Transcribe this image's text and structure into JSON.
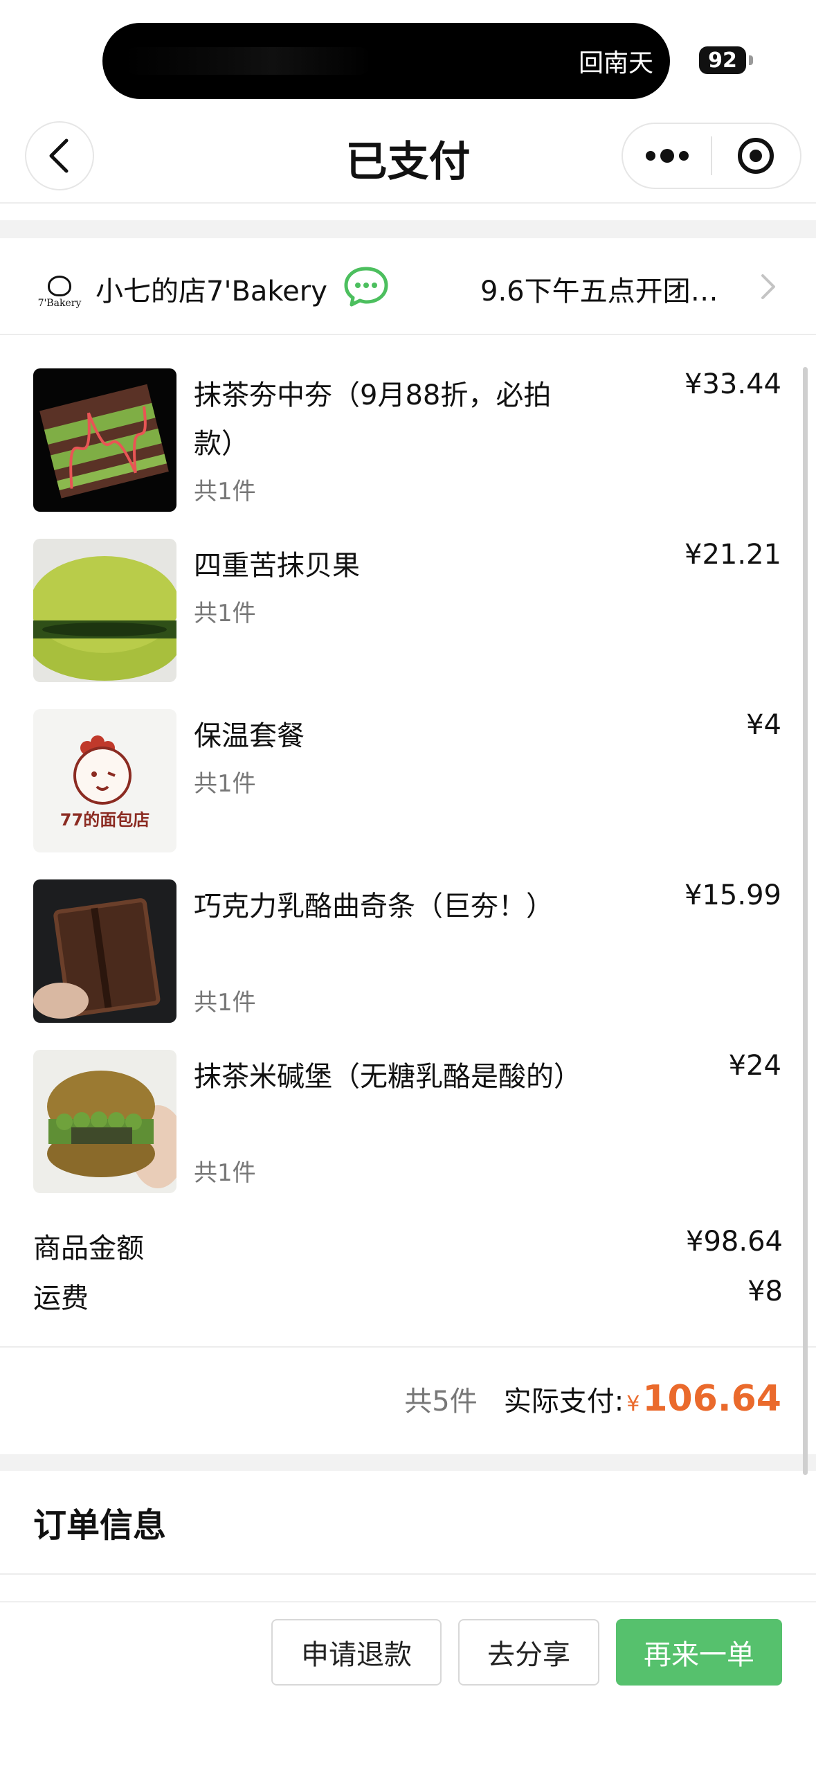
{
  "status_bar": {
    "island_text": "回南天",
    "battery": "92"
  },
  "nav": {
    "title": "已支付",
    "back_icon": "chevron-left-icon",
    "more_icon": "more-dots-icon",
    "close_icon": "target-icon"
  },
  "shop": {
    "logo_text": "7'Bakery",
    "name": "小七的店7'Bakery",
    "chat_icon": "wechat-chat-icon",
    "notice": "9.6下午五点开团…"
  },
  "products": [
    {
      "name": "抹茶夯中夯（9月88折，必拍款）",
      "count": "共1件",
      "price": "¥33.44"
    },
    {
      "name": "四重苦抹贝果",
      "count": "共1件",
      "price": "¥21.21"
    },
    {
      "name": "保温套餐",
      "count": "共1件",
      "price": "¥4",
      "image_text": "77的面包店"
    },
    {
      "name": "巧克力乳酪曲奇条（巨夯！）",
      "count": "共1件",
      "price": "¥15.99"
    },
    {
      "name": "抹茶米碱堡（无糖乳酪是酸的）",
      "count": "共1件",
      "price": "¥24"
    }
  ],
  "summary": {
    "goods_label": "商品金额",
    "goods_value": "¥98.64",
    "shipping_label": "运费",
    "shipping_value": "¥8"
  },
  "total": {
    "count": "共5件",
    "label": "实际支付:",
    "currency": "¥",
    "amount": "106.64"
  },
  "order_info": {
    "title": "订单信息"
  },
  "actions": {
    "refund": "申请退款",
    "share": "去分享",
    "reorder": "再来一单"
  },
  "colors": {
    "accent_green": "#56c16d",
    "price_orange": "#ea6a2c",
    "chat_green": "#4cbf5e"
  }
}
